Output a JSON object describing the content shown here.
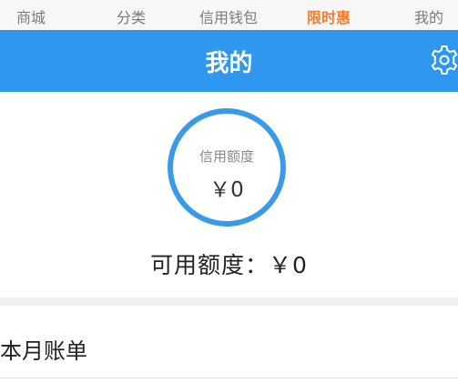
{
  "top_nav": {
    "tabs": [
      {
        "label": "商城"
      },
      {
        "label": "分类"
      },
      {
        "label": "信用钱包"
      },
      {
        "label": "限时惠"
      },
      {
        "label": "我的"
      }
    ],
    "active_index": 3,
    "active_color": "#ef7d2c"
  },
  "header": {
    "title": "我的",
    "settings_icon": "gear-icon",
    "background_color": "#2f97ee"
  },
  "credit": {
    "circle_label": "信用额度",
    "circle_value": "￥0",
    "available_text": "可用额度：￥0",
    "ring_color": "#3a9ae8"
  },
  "bill": {
    "label": "本月账单"
  }
}
